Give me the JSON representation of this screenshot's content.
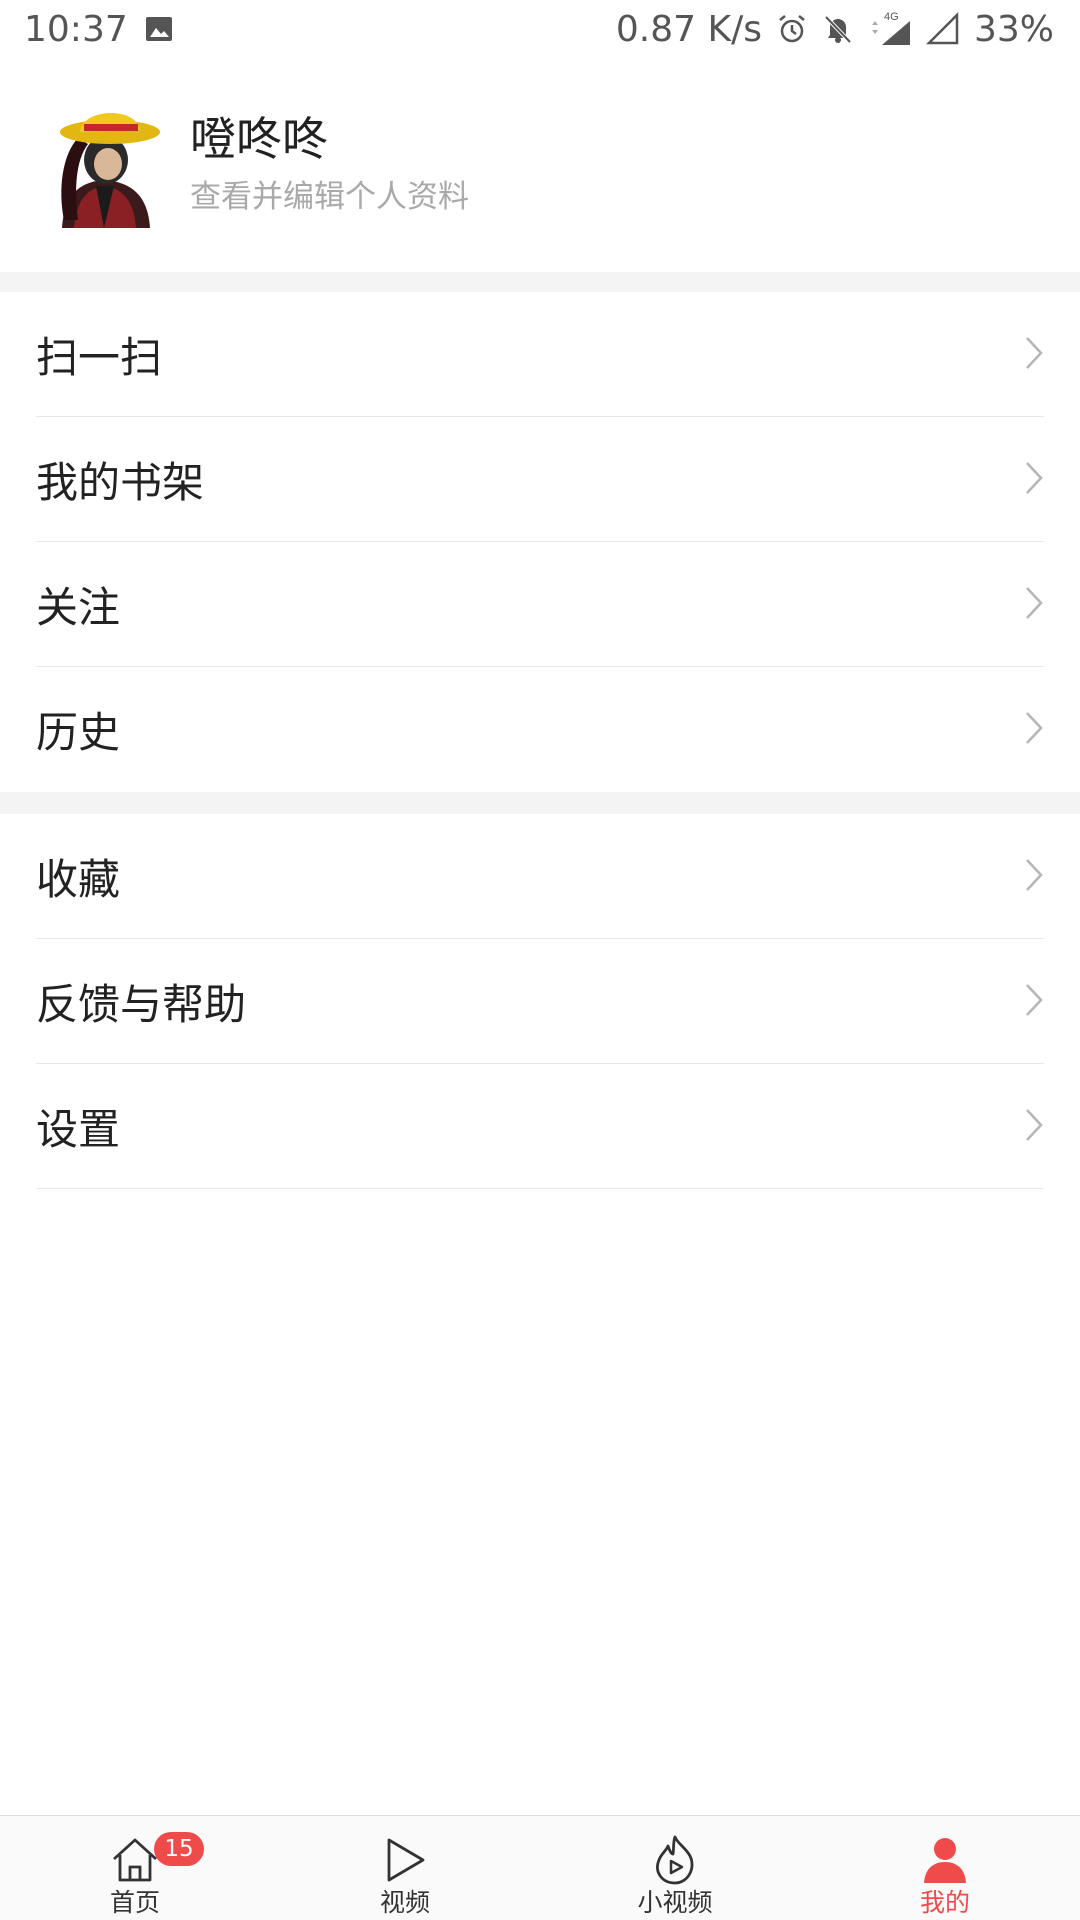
{
  "status_bar": {
    "time": "10:37",
    "speed": "0.87 K/s",
    "network": "4G",
    "battery": "33%",
    "icons": [
      "image-icon",
      "alarm-icon",
      "bell-off-icon",
      "signal-4g-icon",
      "signal-icon"
    ]
  },
  "profile": {
    "username": "噔咚咚",
    "subtitle": "查看并编辑个人资料"
  },
  "menu_group_1": [
    {
      "label": "扫一扫"
    },
    {
      "label": "我的书架"
    },
    {
      "label": "关注"
    },
    {
      "label": "历史"
    }
  ],
  "menu_group_2": [
    {
      "label": "收藏"
    },
    {
      "label": "反馈与帮助"
    },
    {
      "label": "设置"
    }
  ],
  "bottom_nav": {
    "items": [
      {
        "label": "首页",
        "icon": "home-icon",
        "badge": "15"
      },
      {
        "label": "视频",
        "icon": "play-icon"
      },
      {
        "label": "小视频",
        "icon": "flame-play-icon"
      },
      {
        "label": "我的",
        "icon": "person-icon",
        "active": true
      }
    ]
  },
  "colors": {
    "accent": "#f04b4b",
    "text": "#222222",
    "subtext": "#a9a9a9",
    "divider": "#e7e7e7",
    "band": "#f4f4f4"
  }
}
